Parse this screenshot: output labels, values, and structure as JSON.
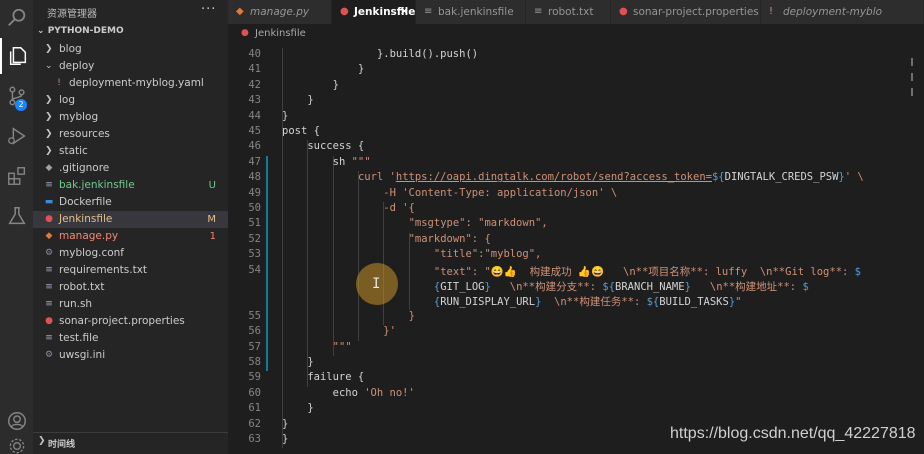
{
  "activity_bar": {
    "items": [
      {
        "name": "search-icon",
        "top": 0
      },
      {
        "name": "explorer-icon",
        "active": true
      },
      {
        "name": "source-control-icon",
        "badge": "2"
      },
      {
        "name": "run-debug-icon"
      },
      {
        "name": "extensions-icon"
      },
      {
        "name": "testing-icon"
      },
      {
        "name": "account-icon"
      },
      {
        "name": "settings-gear-icon"
      }
    ]
  },
  "sidebar": {
    "title": "资源管理器",
    "more": "···",
    "section": "PYTHON-DEMO",
    "timeline_label": "时间线"
  },
  "tree": [
    {
      "label": "blog",
      "type": "folder",
      "expanded": false,
      "indent": 0
    },
    {
      "label": "deploy",
      "type": "folder",
      "expanded": true,
      "indent": 0
    },
    {
      "label": "deployment-myblog.yaml",
      "type": "yaml",
      "indent": 1,
      "icon": "!"
    },
    {
      "label": "log",
      "type": "folder",
      "expanded": false,
      "indent": 0
    },
    {
      "label": "myblog",
      "type": "folder",
      "expanded": false,
      "indent": 0
    },
    {
      "label": "resources",
      "type": "folder",
      "expanded": false,
      "indent": 0
    },
    {
      "label": "static",
      "type": "folder",
      "expanded": false,
      "indent": 0
    },
    {
      "label": ".gitignore",
      "type": "git",
      "indent": 0,
      "icon": "◆"
    },
    {
      "label": "bak.jenkinsfile",
      "type": "file",
      "indent": 0,
      "icon": "≡",
      "status": "U",
      "color": "#73c991"
    },
    {
      "label": "Dockerfile",
      "type": "docker",
      "indent": 0,
      "icon": "▬"
    },
    {
      "label": "Jenkinsfile",
      "type": "jenkins",
      "indent": 0,
      "icon": "●",
      "status": "M",
      "color": "#e2c08d",
      "selected": true
    },
    {
      "label": "manage.py",
      "type": "python",
      "indent": 0,
      "icon": "◆",
      "status": "1",
      "color": "#f48771"
    },
    {
      "label": "myblog.conf",
      "type": "gear",
      "indent": 0,
      "icon": "⚙"
    },
    {
      "label": "requirements.txt",
      "type": "file",
      "indent": 0,
      "icon": "≡"
    },
    {
      "label": "robot.txt",
      "type": "file",
      "indent": 0,
      "icon": "≡"
    },
    {
      "label": "run.sh",
      "type": "file",
      "indent": 0,
      "icon": "≡"
    },
    {
      "label": "sonar-project.properties",
      "type": "sonar",
      "indent": 0,
      "icon": "●"
    },
    {
      "label": "test.file",
      "type": "file",
      "indent": 0,
      "icon": "≡"
    },
    {
      "label": "uwsgi.ini",
      "type": "gear",
      "indent": 0,
      "icon": "⚙"
    }
  ],
  "tabs": [
    {
      "label": "manage.py",
      "icon": "◆",
      "icon_color": "#e37933",
      "italic": true
    },
    {
      "label": "Jenkinsfile",
      "icon": "●",
      "icon_color": "#e05252",
      "active": true,
      "close": "✕"
    },
    {
      "label": "bak.jenkinsfile",
      "icon": "≡",
      "icon_color": "#999999"
    },
    {
      "label": "robot.txt",
      "icon": "≡",
      "icon_color": "#999999"
    },
    {
      "label": "sonar-project.properties",
      "icon": "●",
      "icon_color": "#e05252"
    },
    {
      "label": "deployment-myblo",
      "icon": "!",
      "icon_color": "#c586c0",
      "italic": true
    }
  ],
  "breadcrumb": {
    "label": "Jenkinsfile",
    "icon": "●"
  },
  "editor": {
    "line_numbers": [
      "40",
      "41",
      "42",
      "43",
      "44",
      "45",
      "46",
      "47",
      "48",
      "49",
      "50",
      "51",
      "52",
      "53",
      "54",
      "",
      "",
      "55",
      "56",
      "57",
      "58",
      "59",
      "60",
      "61",
      "62",
      "63"
    ],
    "modified_lines_from": 7,
    "modified_lines_to": 20
  },
  "code_lines": [
    {
      "indent": 15,
      "segments": [
        {
          "t": "}.build().push()",
          "c": "p"
        }
      ]
    },
    {
      "indent": 12,
      "segments": [
        {
          "t": "}",
          "c": "p"
        }
      ]
    },
    {
      "indent": 8,
      "segments": [
        {
          "t": "}",
          "c": "p"
        }
      ]
    },
    {
      "indent": 4,
      "segments": [
        {
          "t": "}",
          "c": "p"
        }
      ]
    },
    {
      "indent": 0,
      "segments": [
        {
          "t": "}",
          "c": "p"
        }
      ]
    },
    {
      "indent": 0,
      "segments": [
        {
          "t": "post {",
          "c": "p"
        }
      ]
    },
    {
      "indent": 4,
      "segments": [
        {
          "t": "success {",
          "c": "p"
        }
      ]
    },
    {
      "indent": 8,
      "segments": [
        {
          "t": "sh ",
          "c": "p"
        },
        {
          "t": "\"\"\"",
          "c": "s"
        }
      ]
    },
    {
      "indent": 12,
      "segments": [
        {
          "t": "curl '",
          "c": "s"
        },
        {
          "t": "https://oapi.dingtalk.com/robot/send?access_token=",
          "c": "u"
        },
        {
          "t": "${",
          "c": "v"
        },
        {
          "t": "DINGTALK_CREDS_PSW",
          "c": "p"
        },
        {
          "t": "}",
          "c": "v"
        },
        {
          "t": "' \\",
          "c": "s"
        }
      ]
    },
    {
      "indent": 16,
      "segments": [
        {
          "t": "-H 'Content-Type: application/json' \\",
          "c": "s"
        }
      ]
    },
    {
      "indent": 16,
      "segments": [
        {
          "t": "-d '{",
          "c": "s"
        }
      ]
    },
    {
      "indent": 20,
      "segments": [
        {
          "t": "\"msgtype\": \"markdown\",",
          "c": "s"
        }
      ]
    },
    {
      "indent": 20,
      "segments": [
        {
          "t": "\"markdown\": {",
          "c": "s"
        }
      ]
    },
    {
      "indent": 24,
      "segments": [
        {
          "t": "\"title\":\"myblog\",",
          "c": "s"
        }
      ]
    },
    {
      "indent": 24,
      "segments": [
        {
          "t": "\"text\": \"😄👍  构建成功 👍😄   \\n**项目名称**: luffy  \\n**Git log**: ",
          "c": "s"
        },
        {
          "t": "$",
          "c": "v"
        }
      ]
    },
    {
      "indent": 24,
      "segments": [
        {
          "t": "{",
          "c": "v"
        },
        {
          "t": "GIT_LOG",
          "c": "p"
        },
        {
          "t": "}",
          "c": "v"
        },
        {
          "t": "   \\n**构建分支**: ",
          "c": "s"
        },
        {
          "t": "${",
          "c": "v"
        },
        {
          "t": "BRANCH_NAME",
          "c": "p"
        },
        {
          "t": "}",
          "c": "v"
        },
        {
          "t": "   \\n**构建地址**: ",
          "c": "s"
        },
        {
          "t": "$",
          "c": "v"
        }
      ]
    },
    {
      "indent": 24,
      "segments": [
        {
          "t": "{",
          "c": "v"
        },
        {
          "t": "RUN_DISPLAY_URL",
          "c": "p"
        },
        {
          "t": "}",
          "c": "v"
        },
        {
          "t": "  \\n**构建任务**: ",
          "c": "s"
        },
        {
          "t": "${",
          "c": "v"
        },
        {
          "t": "BUILD_TASKS",
          "c": "p"
        },
        {
          "t": "}",
          "c": "v"
        },
        {
          "t": "\"",
          "c": "s"
        }
      ]
    },
    {
      "indent": 20,
      "segments": [
        {
          "t": "}",
          "c": "s"
        }
      ]
    },
    {
      "indent": 16,
      "segments": [
        {
          "t": "}'",
          "c": "s"
        }
      ]
    },
    {
      "indent": 8,
      "segments": [
        {
          "t": "\"\"\"",
          "c": "s"
        }
      ]
    },
    {
      "indent": 4,
      "segments": [
        {
          "t": "}",
          "c": "p"
        }
      ]
    },
    {
      "indent": 4,
      "segments": [
        {
          "t": "failure {",
          "c": "p"
        }
      ]
    },
    {
      "indent": 8,
      "segments": [
        {
          "t": "echo ",
          "c": "p"
        },
        {
          "t": "'Oh no!'",
          "c": "s"
        }
      ]
    },
    {
      "indent": 4,
      "segments": [
        {
          "t": "}",
          "c": "p"
        }
      ]
    },
    {
      "indent": 0,
      "segments": [
        {
          "t": "}",
          "c": "p"
        }
      ]
    },
    {
      "indent": 0,
      "segments": [
        {
          "t": "}",
          "c": "p"
        }
      ]
    }
  ],
  "watermark": "https://blog.csdn.net/qq_42227818"
}
